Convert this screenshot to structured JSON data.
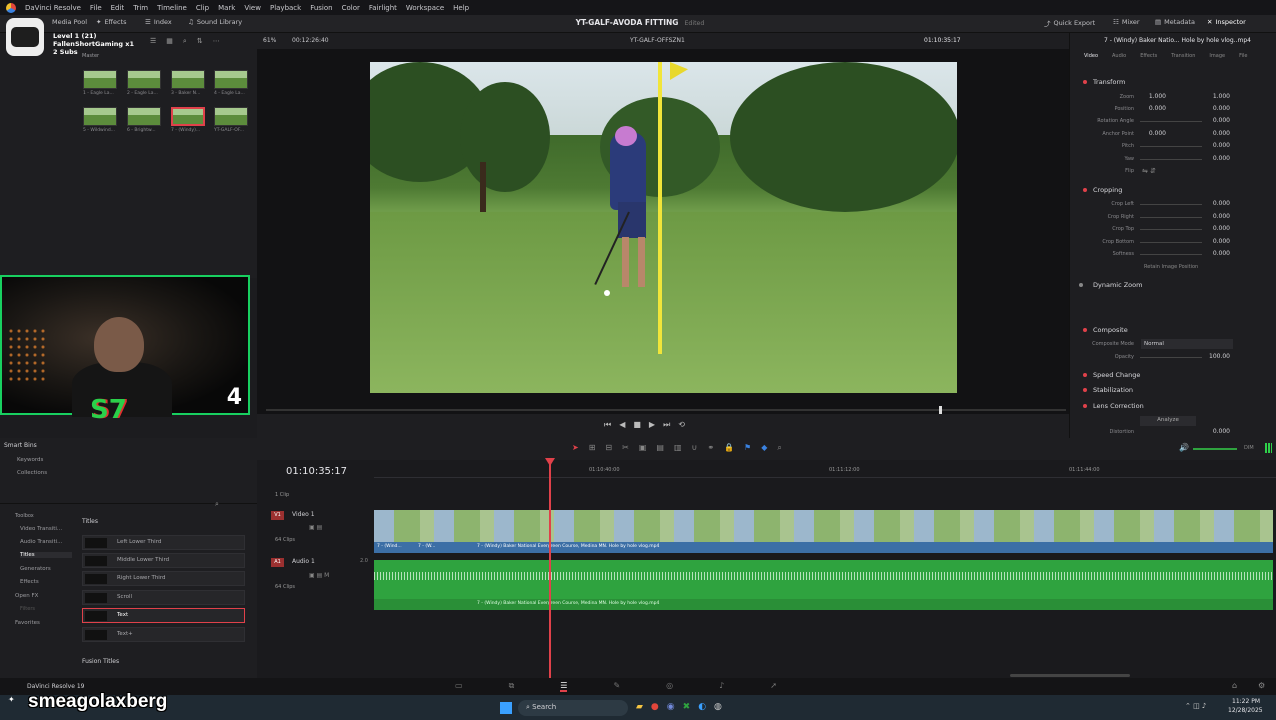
{
  "menu": {
    "app": "DaVinci Resolve",
    "items": [
      "File",
      "Edit",
      "Trim",
      "Timeline",
      "Clip",
      "Mark",
      "View",
      "Playback",
      "Fusion",
      "Color",
      "Fairlight",
      "Workspace",
      "Help"
    ]
  },
  "toolbar": {
    "media_pool": "Media Pool",
    "effects": "Effects",
    "index": "Index",
    "sound_library": "Sound Library",
    "project": "YT-GALF-AVODA FITTING",
    "edited": "Edited",
    "quick_export": "Quick Export",
    "mixer": "Mixer",
    "metadata": "Metadata",
    "inspector": "Inspector"
  },
  "overlay": {
    "level": "Level 1 (21)",
    "name": "FallenShortGaming x1",
    "subs": "2 Subs",
    "master": "Master",
    "username": "smeagolaxberg",
    "cam_number": "4"
  },
  "mediapool": {
    "zoom_btn": "",
    "clips": [
      {
        "label": "1 - Eagle La..."
      },
      {
        "label": "2 - Eagle La..."
      },
      {
        "label": "3 - Baker N..."
      },
      {
        "label": "4 - Eagle La..."
      },
      {
        "label": "5 - Wildwind..."
      },
      {
        "label": "6 - Brightw..."
      },
      {
        "label": "7 - (Windy)..."
      },
      {
        "label": "YT-GALF-OF..."
      }
    ]
  },
  "bins": {
    "smart_bins": "Smart Bins",
    "keywords": "Keywords",
    "collections": "Collections"
  },
  "effects": {
    "toolbox": "Toolbox",
    "video_transitions": "Video Transiti...",
    "audio_transitions": "Audio Transiti...",
    "titles": "Titles",
    "generators": "Generators",
    "effects": "Effects",
    "open_fx": "Open FX",
    "filters": "Filters",
    "favorites": "Favorites",
    "titles_header": "Titles",
    "fusion_titles": "Fusion Titles",
    "items": [
      "Left Lower Third",
      "Middle Lower Third",
      "Right Lower Third",
      "Scroll",
      "Text",
      "Text+"
    ]
  },
  "viewer": {
    "zoom": "61%",
    "timecode_left": "00:12:26:40",
    "timeline_name": "YT-GALF-OFFSZN1",
    "timecode_right": "01:10:35:17"
  },
  "inspector": {
    "clip_title": "7 - (Windy) Baker Natio... Hole by hole vlog..mp4",
    "tabs": [
      "Video",
      "Audio",
      "Effects",
      "Transition",
      "Image",
      "File"
    ],
    "transform": "Transform",
    "zoom": "Zoom",
    "position": "Position",
    "rotation": "Rotation Angle",
    "anchor": "Anchor Point",
    "pitch": "Pitch",
    "yaw": "Yaw",
    "flip": "Flip",
    "zoom_x": "1.000",
    "zoom_y": "1.000",
    "pos_x": "0.000",
    "pos_y": "0.000",
    "rot": "0.000",
    "anc_x": "0.000",
    "anc_y": "0.000",
    "pitch_v": "0.000",
    "yaw_v": "0.000",
    "cropping": "Cropping",
    "crop_left": "Crop Left",
    "crop_right": "Crop Right",
    "crop_top": "Crop Top",
    "crop_bottom": "Crop Bottom",
    "softness": "Softness",
    "retain": "Retain Image Position",
    "cl": "0.000",
    "cr": "0.000",
    "ct": "0.000",
    "cb": "0.000",
    "sf": "0.000",
    "dynamic_zoom": "Dynamic Zoom",
    "composite": "Composite",
    "composite_mode": "Composite Mode",
    "mode_val": "Normal",
    "opacity": "Opacity",
    "opacity_val": "100.00",
    "speed_change": "Speed Change",
    "stabilization": "Stabilization",
    "lens_correction": "Lens Correction",
    "analyze": "Analyze",
    "distortion": "Distortion",
    "dist_val": "0.000"
  },
  "timeline": {
    "timecode": "01:10:35:17",
    "track_top_label": "1 Clip",
    "v1": "V1",
    "video1": "Video 1",
    "v_clips": "64 Clips",
    "a1": "A1",
    "audio1": "Audio 1",
    "a_clips": "64 Clips",
    "audio_level": "2.0",
    "ruler": [
      "01:10:40:00",
      "01:11:12:00",
      "01:11:44:00"
    ],
    "clip_label": "7 - (Windy) Baker National Evergreen Course, Medina MN. Hole by hole vlog.mp4",
    "clip_short1": "7 - (Wind...",
    "clip_short2": "7 - (W..."
  },
  "pages": {
    "app_version": "DaVinci Resolve 19"
  },
  "taskbar": {
    "search": "Search",
    "time": "11:22 PM",
    "date": "12/28/2025"
  },
  "colors": {
    "accent_red": "#e0414a",
    "clip_blue": "#3c6fa6",
    "audio_green": "#2fa33f",
    "webcam_border": "#18d060"
  }
}
